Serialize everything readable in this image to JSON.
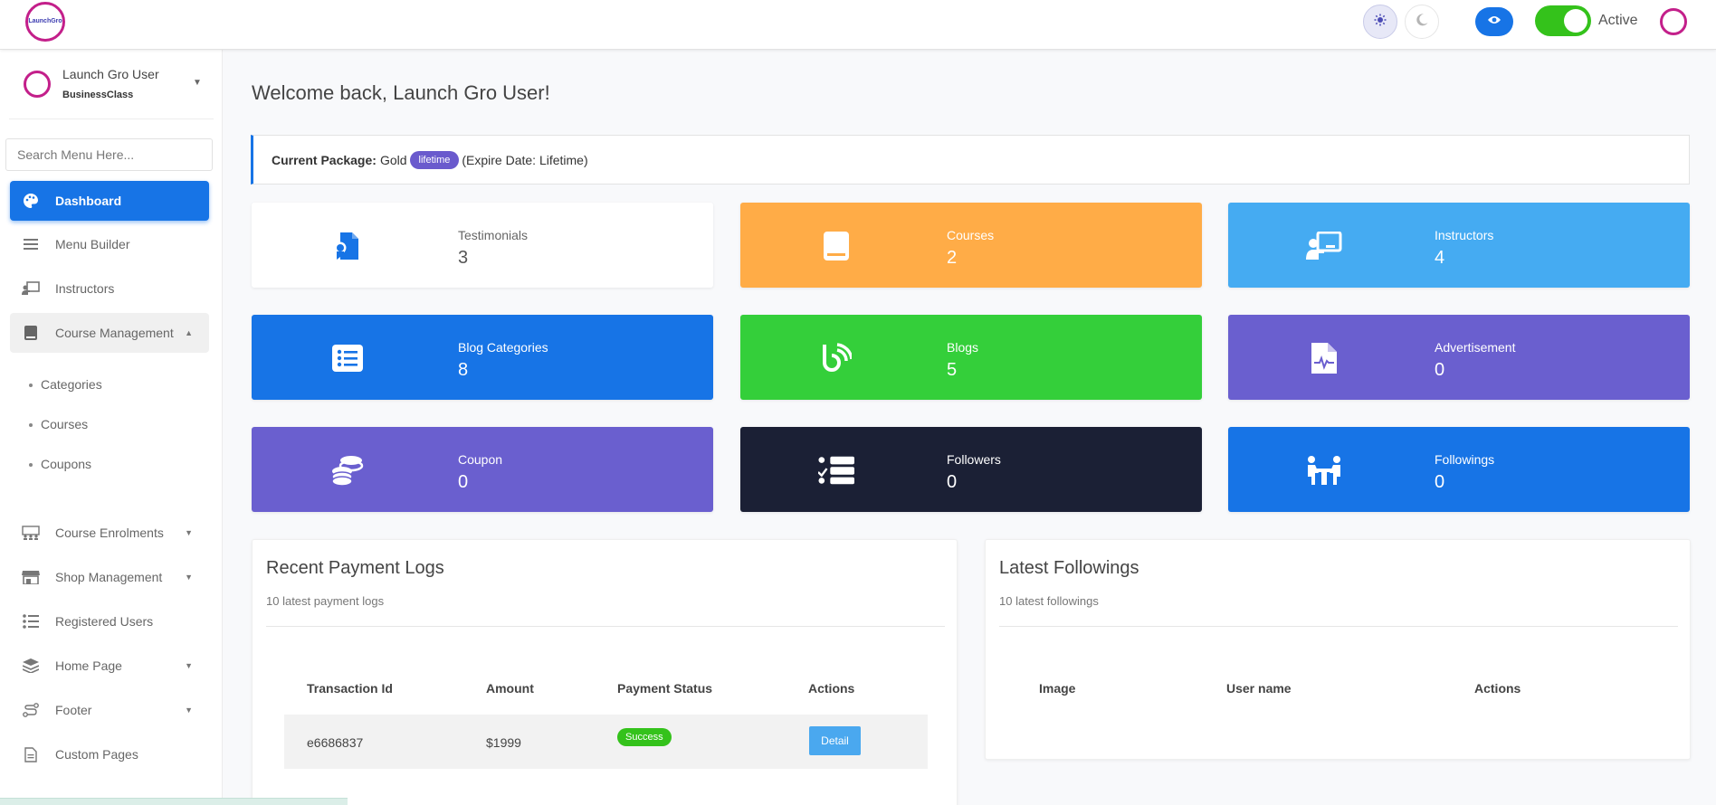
{
  "header": {
    "logo_text": "LaunchGro",
    "toggle_label": "Active",
    "icons": [
      "sun-icon",
      "moon-icon",
      "eye-icon"
    ]
  },
  "sidebar": {
    "user_name": "Launch Gro User",
    "user_plan": "BusinessClass",
    "search_placeholder": "Search Menu Here...",
    "items": [
      {
        "label": "Dashboard",
        "icon": "palette-icon",
        "active": true
      },
      {
        "label": "Menu Builder",
        "icon": "bars-icon"
      },
      {
        "label": "Instructors",
        "icon": "chalkboard-teacher-icon"
      },
      {
        "label": "Course Management",
        "icon": "book-icon",
        "open": true
      },
      {
        "label": "Course Enrolments",
        "icon": "users-icon"
      },
      {
        "label": "Shop Management",
        "icon": "store-icon"
      },
      {
        "label": "Registered Users",
        "icon": "list-icon"
      },
      {
        "label": "Home Page",
        "icon": "layer-group-icon"
      },
      {
        "label": "Footer",
        "icon": "route-icon"
      },
      {
        "label": "Custom Pages",
        "icon": "file-icon"
      }
    ],
    "sub_items": [
      "Categories",
      "Courses",
      "Coupons"
    ]
  },
  "main": {
    "welcome": "Welcome back, Launch Gro User!",
    "package": {
      "label": "Current Package:",
      "name": "Gold",
      "badge": "lifetime",
      "expire": "(Expire Date: Lifetime)"
    },
    "cards": [
      {
        "label": "Testimonials",
        "value": "3",
        "color": "#ffffff",
        "icon": "award-icon"
      },
      {
        "label": "Courses",
        "value": "2",
        "color": "#ffac47",
        "icon": "book-icon"
      },
      {
        "label": "Instructors",
        "value": "4",
        "color": "#45abf2",
        "icon": "chalkboard-teacher-icon"
      },
      {
        "label": "Blog Categories",
        "value": "8",
        "color": "#1774e6",
        "icon": "list-alt-icon"
      },
      {
        "label": "Blogs",
        "value": "5",
        "color": "#34cf3a",
        "icon": "blog-icon"
      },
      {
        "label": "Advertisement",
        "value": "0",
        "color": "#6a5fcf",
        "icon": "file-medical-icon"
      },
      {
        "label": "Coupon",
        "value": "0",
        "color": "#6a5fcf",
        "icon": "coins-icon"
      },
      {
        "label": "Followers",
        "value": "0",
        "color": "#1b2035",
        "icon": "list-check-icon"
      },
      {
        "label": "Followings",
        "value": "0",
        "color": "#1774e6",
        "icon": "people-table-icon"
      }
    ],
    "payments": {
      "title": "Recent Payment Logs",
      "subtitle": "10 latest payment logs",
      "columns": [
        "Transaction Id",
        "Amount",
        "Payment Status",
        "Actions"
      ],
      "rows": [
        {
          "transaction_id": "e6686837",
          "amount": "$1999",
          "status": "Success",
          "action": "Detail"
        }
      ]
    },
    "followings": {
      "title": "Latest Followings",
      "subtitle": "10 latest followings",
      "columns": [
        "Image",
        "User name",
        "Actions"
      ]
    }
  },
  "colors": {
    "primary": "#1774e6",
    "success": "#34c21b",
    "brand": "#c31f8a",
    "badge": "#6a5acd"
  }
}
